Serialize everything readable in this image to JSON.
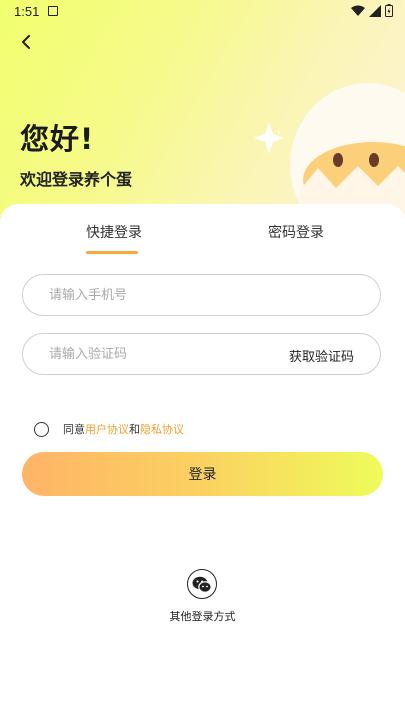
{
  "status_bar": {
    "time": "1:51"
  },
  "header": {
    "greeting": "您好!",
    "subtitle": "欢迎登录养个蛋"
  },
  "tabs": [
    {
      "label": "快捷登录",
      "active": true
    },
    {
      "label": "密码登录",
      "active": false
    }
  ],
  "form": {
    "phone_placeholder": "请输入手机号",
    "code_placeholder": "请输入验证码",
    "get_code_label": "获取验证码"
  },
  "agreement": {
    "prefix": "同意",
    "user_agreement": "用户协议",
    "and": "和",
    "privacy_policy": "隐私协议",
    "checked": false
  },
  "login_label": "登录",
  "other_login_label": "其他登录方式",
  "colors": {
    "accent": "#f4a93a",
    "link": "#f0a030"
  }
}
